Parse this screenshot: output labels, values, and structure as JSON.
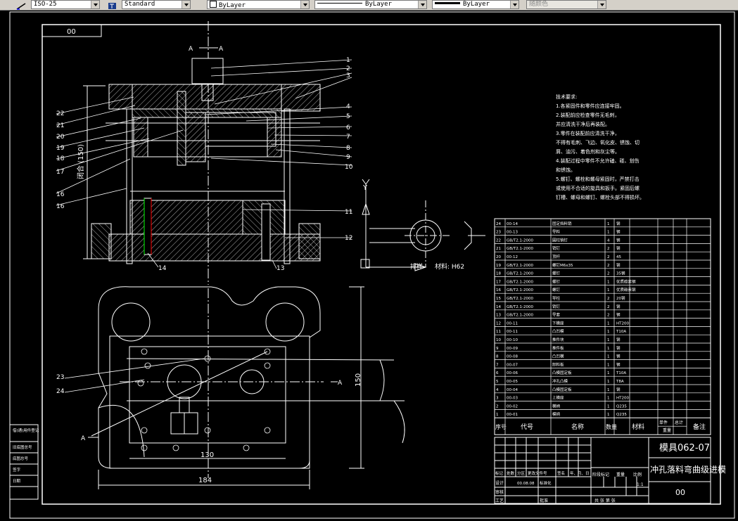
{
  "toolbar": {
    "dimstyle": "ISO-25",
    "textstyle": "Standard",
    "layer": "ByLayer",
    "linetype": "ByLayer",
    "lineweight": "ByLayer",
    "plotstyle": "随颜色"
  },
  "colors": {
    "accent": "#ffffff",
    "highlight": "#00ff00",
    "warning": "#ff0000"
  },
  "drawing": {
    "code_box": "00",
    "section_label_a": "A",
    "section_label_a2": "A",
    "callouts": [
      "1",
      "2",
      "3",
      "4",
      "5",
      "6",
      "7",
      "8",
      "9",
      "10",
      "11",
      "12",
      "13",
      "14",
      "15",
      "16",
      "17",
      "18",
      "19",
      "20",
      "21",
      "22",
      "23",
      "24"
    ],
    "dim_h": "闭合 (150)",
    "dim_150": "150",
    "dim_130": "130",
    "dim_184": "184",
    "axis_y": "Y",
    "material": "材料: H62",
    "strip_label": "排样",
    "tech_req": {
      "title": "技术要求:",
      "lines": [
        "1.各紧固件和零件应连接牢固。",
        "2.装配前应检查零件无毛刺，",
        "  并应清洗干净后再装配。",
        "3.零件在装配前应清洗干净，",
        "  不得有毛刺、飞边、氧化皮、锈蚀、切",
        "  屑、油污、着色剂和灰尘等。",
        "4.装配过程中零件不允许磕、碰、划伤",
        "  和锈蚀。",
        "5.螺钉、螺栓和螺母紧固时，严禁打击",
        "  或使用不合适的旋具和扳手。紧固后螺",
        "  钉槽、螺母和螺钉、螺栓头部不得损坏。"
      ]
    }
  },
  "bom": {
    "header": {
      "no": "序号",
      "code": "代号",
      "name": "名称",
      "qty": "数量",
      "material": "材料",
      "single": "单件",
      "total": "总计",
      "weight": "重量",
      "note": "备注"
    },
    "rows": [
      {
        "no": "24",
        "code": "00-14",
        "name": "固定挡料销",
        "qty": "1",
        "mat": "钢"
      },
      {
        "no": "23",
        "code": "00-13",
        "name": "导料",
        "qty": "1",
        "mat": "钢"
      },
      {
        "no": "22",
        "code": "GB/T2.1-2000",
        "name": "圆柱销钉",
        "qty": "4",
        "mat": "钢"
      },
      {
        "no": "21",
        "code": "GB/T2.1-2000",
        "name": "销钉",
        "qty": "2",
        "mat": "钢"
      },
      {
        "no": "20",
        "code": "00-12",
        "name": "顶杆",
        "qty": "2",
        "mat": "45"
      },
      {
        "no": "19",
        "code": "GB/T2.1-2000",
        "name": "螺钉M6x35",
        "qty": "2",
        "mat": "钢"
      },
      {
        "no": "18",
        "code": "GB/T2.1-2000",
        "name": "螺钉",
        "qty": "2",
        "mat": "35钢"
      },
      {
        "no": "17",
        "code": "GB/T2.1-2000",
        "name": "螺钉",
        "qty": "1",
        "mat": "优质碳素钢"
      },
      {
        "no": "16",
        "code": "GB/T2.1-2000",
        "name": "螺钉",
        "qty": "1",
        "mat": "优质碳素钢"
      },
      {
        "no": "15",
        "code": "GB/T2.1-2000",
        "name": "导柱",
        "qty": "2",
        "mat": "20钢"
      },
      {
        "no": "14",
        "code": "GB/T2.1-2000",
        "name": "销钉",
        "qty": "2",
        "mat": "钢"
      },
      {
        "no": "13",
        "code": "GB/T2.1-2000",
        "name": "导套",
        "qty": "2",
        "mat": "钢"
      },
      {
        "no": "12",
        "code": "00-11",
        "name": "下模座",
        "qty": "1",
        "mat": "HT200"
      },
      {
        "no": "11",
        "code": "00-11",
        "name": "凸凹模",
        "qty": "1",
        "mat": "T10A"
      },
      {
        "no": "10",
        "code": "00-10",
        "name": "推件块",
        "qty": "1",
        "mat": "钢"
      },
      {
        "no": "9",
        "code": "00-09",
        "name": "推件板",
        "qty": "1",
        "mat": "钢"
      },
      {
        "no": "8",
        "code": "00-08",
        "name": "凸凹模",
        "qty": "1",
        "mat": "钢"
      },
      {
        "no": "7",
        "code": "00-07",
        "name": "卸料板",
        "qty": "1",
        "mat": "钢"
      },
      {
        "no": "6",
        "code": "00-06",
        "name": "凸模固定板",
        "qty": "1",
        "mat": "T10A"
      },
      {
        "no": "5",
        "code": "00-05",
        "name": "冲孔凸模",
        "qty": "1",
        "mat": "T8A"
      },
      {
        "no": "4",
        "code": "00-04",
        "name": "凸模固定板",
        "qty": "1",
        "mat": "钢"
      },
      {
        "no": "3",
        "code": "00-03",
        "name": "上模座",
        "qty": "1",
        "mat": "HT200"
      },
      {
        "no": "2",
        "code": "00-02",
        "name": "模柄",
        "qty": "1",
        "mat": "Q235"
      },
      {
        "no": "1",
        "code": "00-01",
        "name": "模柄",
        "qty": "1",
        "mat": "Q235"
      }
    ]
  },
  "titleblock": {
    "drawing_no": "模具062-07",
    "drawing_title": "冲孔落料弯曲级进模",
    "code": "00",
    "scale": "1:1",
    "row_labels": [
      "标记",
      "处数",
      "分区",
      "更改文件号",
      "签名",
      "年、月、日"
    ],
    "design": "设计",
    "standardize": "标准化",
    "review": "审核",
    "process": "工艺",
    "approve": "批准",
    "stage": "阶段标记",
    "weight": "重量",
    "ratio": "比例",
    "sheet": "共 张 第 张",
    "date": "00.08.08"
  },
  "left_margin": [
    "借(通)用件登记",
    "旧底图总号",
    "底图总号",
    "签字",
    "日期"
  ]
}
